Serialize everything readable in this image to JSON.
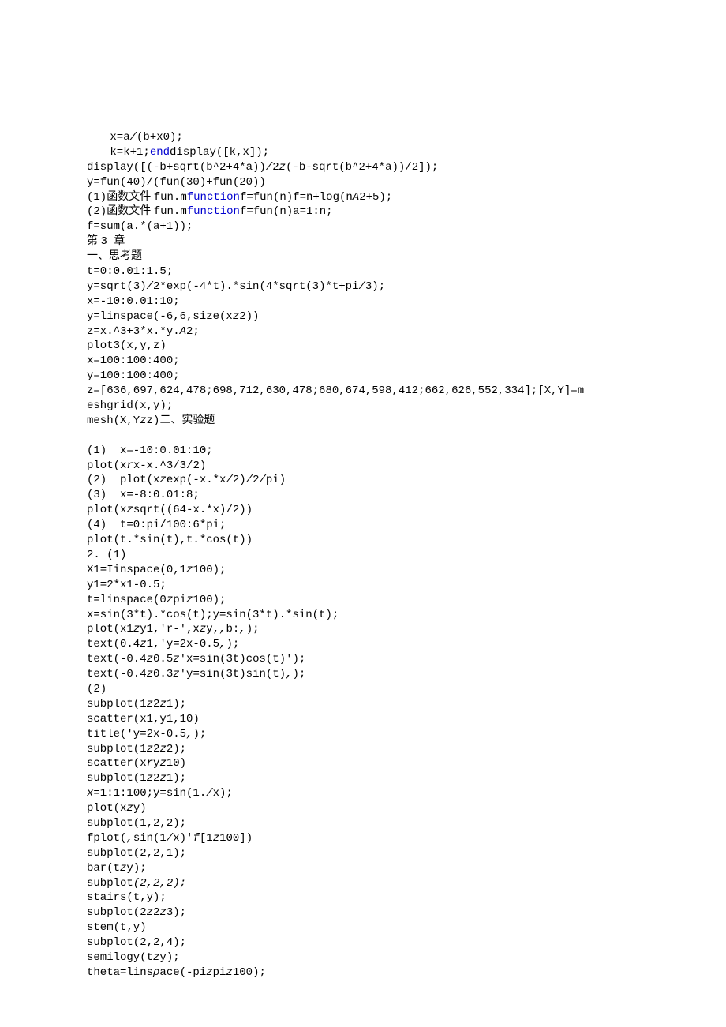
{
  "lines": [
    {
      "indent": true,
      "parts": [
        {
          "t": "x=a",
          "c": ""
        },
        {
          "t": "/",
          "c": "it"
        },
        {
          "t": "(b+x0);",
          "c": ""
        }
      ]
    },
    {
      "indent": true,
      "parts": [
        {
          "t": "k=k+1;",
          "c": ""
        },
        {
          "t": "end",
          "c": "kw"
        },
        {
          "t": "display([k,x]);",
          "c": ""
        }
      ]
    },
    {
      "parts": [
        {
          "t": "display([(-b+sqrt(b^2+4*a))",
          "c": ""
        },
        {
          "t": "/",
          "c": "it"
        },
        {
          "t": "2",
          "c": ""
        },
        {
          "t": "z",
          "c": "it"
        },
        {
          "t": "(-b-sqrt(b^2+4*a))/2]);",
          "c": ""
        }
      ]
    },
    {
      "parts": [
        {
          "t": "y=fun(40)/(fun(30)+fun(20))",
          "c": ""
        }
      ]
    },
    {
      "parts": [
        {
          "t": "(1)",
          "c": ""
        },
        {
          "t": "函数文件 ",
          "c": "zh"
        },
        {
          "t": "fun.m",
          "c": ""
        },
        {
          "t": "function",
          "c": "kw"
        },
        {
          "t": "f=fun(n)f=n+log(n",
          "c": ""
        },
        {
          "t": "A",
          "c": "it"
        },
        {
          "t": "2+5);",
          "c": ""
        }
      ]
    },
    {
      "parts": [
        {
          "t": "(2)",
          "c": ""
        },
        {
          "t": "函数文件 ",
          "c": "zh"
        },
        {
          "t": "fun.m",
          "c": ""
        },
        {
          "t": "function",
          "c": "kw"
        },
        {
          "t": "f=fun(n)a=1:n;",
          "c": ""
        }
      ]
    },
    {
      "parts": [
        {
          "t": "f=sum(a.*(a+1));",
          "c": ""
        }
      ]
    },
    {
      "parts": [
        {
          "t": "第 ",
          "c": "zh"
        },
        {
          "t": "3 ",
          "c": ""
        },
        {
          "t": "章",
          "c": "zh"
        }
      ]
    },
    {
      "parts": [
        {
          "t": "一、思考题",
          "c": "zh"
        }
      ]
    },
    {
      "parts": [
        {
          "t": "t=0:0.01:1.5;",
          "c": ""
        }
      ]
    },
    {
      "parts": [
        {
          "t": "y=sqrt(3)",
          "c": ""
        },
        {
          "t": "/",
          "c": "it"
        },
        {
          "t": "2*exp(-4*t).*sin(4*sqrt(3)*t+pi",
          "c": ""
        },
        {
          "t": "/",
          "c": "it"
        },
        {
          "t": "3);",
          "c": ""
        }
      ]
    },
    {
      "parts": [
        {
          "t": "x=-10:0.01:10;",
          "c": ""
        }
      ]
    },
    {
      "parts": [
        {
          "t": "y=linspace(-6,6,size(x",
          "c": ""
        },
        {
          "t": "z",
          "c": "it"
        },
        {
          "t": "2))",
          "c": ""
        }
      ]
    },
    {
      "parts": [
        {
          "t": "z=x.^3+3*x.*y.",
          "c": ""
        },
        {
          "t": "A",
          "c": "it"
        },
        {
          "t": "2;",
          "c": ""
        }
      ]
    },
    {
      "parts": [
        {
          "t": "plot3(x,y,z)",
          "c": ""
        }
      ]
    },
    {
      "parts": [
        {
          "t": "x=100:100:400;",
          "c": ""
        }
      ]
    },
    {
      "parts": [
        {
          "t": "y=100:100:400;",
          "c": ""
        }
      ]
    },
    {
      "parts": [
        {
          "t": "z=[636,697,624,478;698,712,630,478;680,674,598,412;662,626,552,334];[X,Y]=m",
          "c": ""
        }
      ]
    },
    {
      "parts": [
        {
          "t": "eshgrid(x,y);",
          "c": ""
        }
      ]
    },
    {
      "parts": [
        {
          "t": "mesh(X,Y",
          "c": ""
        },
        {
          "t": "z",
          "c": "it"
        },
        {
          "t": "z)",
          "c": ""
        },
        {
          "t": "二、实验题",
          "c": "zh"
        }
      ]
    },
    {
      "parts": [
        {
          "t": " ",
          "c": ""
        }
      ]
    },
    {
      "parts": [
        {
          "t": "(1)  x=-10:0.01:10;",
          "c": ""
        }
      ]
    },
    {
      "parts": [
        {
          "t": "plot(x",
          "c": ""
        },
        {
          "t": "r",
          "c": "it"
        },
        {
          "t": "x-x.^3/3/2)",
          "c": ""
        }
      ]
    },
    {
      "parts": [
        {
          "t": "(2)  plot(x",
          "c": ""
        },
        {
          "t": "z",
          "c": "it"
        },
        {
          "t": "exp(-x.*x",
          "c": ""
        },
        {
          "t": "/",
          "c": "it"
        },
        {
          "t": "2)",
          "c": ""
        },
        {
          "t": "/",
          "c": "it"
        },
        {
          "t": "2",
          "c": ""
        },
        {
          "t": "/",
          "c": "it"
        },
        {
          "t": "pi)",
          "c": ""
        }
      ]
    },
    {
      "parts": [
        {
          "t": "(3)  x=-8:0.01:8;",
          "c": ""
        }
      ]
    },
    {
      "parts": [
        {
          "t": "plot(x",
          "c": ""
        },
        {
          "t": "z",
          "c": "it"
        },
        {
          "t": "sqrt((64-x.*x)/2))",
          "c": ""
        }
      ]
    },
    {
      "parts": [
        {
          "t": "(4)  t=0:pi/100:6*pi;",
          "c": ""
        }
      ]
    },
    {
      "parts": [
        {
          "t": "plot(t.*sin(t),t.*cos(t))",
          "c": ""
        }
      ]
    },
    {
      "parts": [
        {
          "t": "2. (1)",
          "c": ""
        }
      ]
    },
    {
      "parts": [
        {
          "t": "X1=Iinspace(0,1",
          "c": ""
        },
        {
          "t": "z",
          "c": "it"
        },
        {
          "t": "100);",
          "c": ""
        }
      ]
    },
    {
      "parts": [
        {
          "t": "y1=2*x1-0.5;",
          "c": ""
        }
      ]
    },
    {
      "parts": [
        {
          "t": "t=linspace(0",
          "c": ""
        },
        {
          "t": "z",
          "c": "it"
        },
        {
          "t": "pi",
          "c": ""
        },
        {
          "t": "z",
          "c": "it"
        },
        {
          "t": "100);",
          "c": ""
        }
      ]
    },
    {
      "parts": [
        {
          "t": "x=sin(3*t).*cos(t);y=sin(3*t).*sin(t);",
          "c": ""
        }
      ]
    },
    {
      "parts": [
        {
          "t": "plot(x1",
          "c": ""
        },
        {
          "t": "z",
          "c": "it"
        },
        {
          "t": "y1,'r-',x",
          "c": ""
        },
        {
          "t": "z",
          "c": "it"
        },
        {
          "t": "y,",
          "c": ""
        },
        {
          "t": ",",
          "c": "it"
        },
        {
          "t": "b:",
          "c": ""
        },
        {
          "t": ",",
          "c": "it"
        },
        {
          "t": ");",
          "c": ""
        }
      ]
    },
    {
      "parts": [
        {
          "t": "text(0.4",
          "c": ""
        },
        {
          "t": "z",
          "c": "it"
        },
        {
          "t": "1,'y=2x-0.5",
          "c": ""
        },
        {
          "t": ",",
          "c": "it"
        },
        {
          "t": ");",
          "c": ""
        }
      ]
    },
    {
      "parts": [
        {
          "t": "text(-0.4",
          "c": ""
        },
        {
          "t": "z",
          "c": "it"
        },
        {
          "t": "0.5",
          "c": ""
        },
        {
          "t": "z",
          "c": "it"
        },
        {
          "t": "'x=sin(3t)cos(t)');",
          "c": ""
        }
      ]
    },
    {
      "parts": [
        {
          "t": "text(-0.4",
          "c": ""
        },
        {
          "t": "z",
          "c": "it"
        },
        {
          "t": "0.3",
          "c": ""
        },
        {
          "t": "z",
          "c": "it"
        },
        {
          "t": "'y=sin(3t)sin(t)",
          "c": ""
        },
        {
          "t": ",",
          "c": "it"
        },
        {
          "t": ");",
          "c": ""
        }
      ]
    },
    {
      "parts": [
        {
          "t": "(2)",
          "c": ""
        }
      ]
    },
    {
      "parts": [
        {
          "t": "subplot(1",
          "c": ""
        },
        {
          "t": "z",
          "c": "it"
        },
        {
          "t": "2",
          "c": ""
        },
        {
          "t": "z",
          "c": "it"
        },
        {
          "t": "1);",
          "c": ""
        }
      ]
    },
    {
      "parts": [
        {
          "t": "scatter(x1,y1,10)",
          "c": ""
        }
      ]
    },
    {
      "parts": [
        {
          "t": "title('y=2x-0.5",
          "c": ""
        },
        {
          "t": ",",
          "c": "it"
        },
        {
          "t": ");",
          "c": ""
        }
      ]
    },
    {
      "parts": [
        {
          "t": "subplot(1",
          "c": ""
        },
        {
          "t": "z",
          "c": "it"
        },
        {
          "t": "2",
          "c": ""
        },
        {
          "t": "z",
          "c": "it"
        },
        {
          "t": "2);",
          "c": ""
        }
      ]
    },
    {
      "parts": [
        {
          "t": "scatter(x",
          "c": ""
        },
        {
          "t": "r",
          "c": "it"
        },
        {
          "t": "y",
          "c": ""
        },
        {
          "t": "z",
          "c": "it"
        },
        {
          "t": "10)",
          "c": ""
        }
      ]
    },
    {
      "parts": [
        {
          "t": "subplot(1",
          "c": ""
        },
        {
          "t": "z",
          "c": "it"
        },
        {
          "t": "2",
          "c": ""
        },
        {
          "t": "z",
          "c": "it"
        },
        {
          "t": "1);",
          "c": ""
        }
      ]
    },
    {
      "parts": [
        {
          "t": "x",
          "c": "it"
        },
        {
          "t": "=1:1:100;y=sin(1.",
          "c": ""
        },
        {
          "t": "/",
          "c": "it"
        },
        {
          "t": "x);",
          "c": ""
        }
      ]
    },
    {
      "parts": [
        {
          "t": "plot(x",
          "c": ""
        },
        {
          "t": "z",
          "c": "it"
        },
        {
          "t": "y)",
          "c": ""
        }
      ]
    },
    {
      "parts": [
        {
          "t": "subplot(1,2,2);",
          "c": ""
        }
      ]
    },
    {
      "parts": [
        {
          "t": "fplot(",
          "c": ""
        },
        {
          "t": ",",
          "c": "it"
        },
        {
          "t": "sin(1",
          "c": ""
        },
        {
          "t": "/",
          "c": "it"
        },
        {
          "t": "x)'",
          "c": ""
        },
        {
          "t": "f",
          "c": "it"
        },
        {
          "t": "[1",
          "c": ""
        },
        {
          "t": "z",
          "c": "it"
        },
        {
          "t": "100])",
          "c": ""
        }
      ]
    },
    {
      "parts": [
        {
          "t": "subplot(2,2,1);",
          "c": ""
        }
      ]
    },
    {
      "parts": [
        {
          "t": "bar(t",
          "c": ""
        },
        {
          "t": "z",
          "c": "it"
        },
        {
          "t": "y);",
          "c": ""
        }
      ]
    },
    {
      "parts": [
        {
          "t": "subplot",
          "c": ""
        },
        {
          "t": "(2,2,2);",
          "c": "it"
        }
      ]
    },
    {
      "parts": [
        {
          "t": "stairs(t,y);",
          "c": ""
        }
      ]
    },
    {
      "parts": [
        {
          "t": "subplot(2",
          "c": ""
        },
        {
          "t": "z",
          "c": "it"
        },
        {
          "t": "2",
          "c": ""
        },
        {
          "t": "z",
          "c": "it"
        },
        {
          "t": "3);",
          "c": ""
        }
      ]
    },
    {
      "parts": [
        {
          "t": "stem(t,y)",
          "c": ""
        }
      ]
    },
    {
      "parts": [
        {
          "t": "subplot(2,2,4);",
          "c": ""
        }
      ]
    },
    {
      "parts": [
        {
          "t": "semilogy(t",
          "c": ""
        },
        {
          "t": "z",
          "c": "it"
        },
        {
          "t": "y);",
          "c": ""
        }
      ]
    },
    {
      "parts": [
        {
          "t": "theta=lins",
          "c": ""
        },
        {
          "t": "ρ",
          "c": "it"
        },
        {
          "t": "ace(-pi",
          "c": ""
        },
        {
          "t": "z",
          "c": "it"
        },
        {
          "t": "pi",
          "c": ""
        },
        {
          "t": "z",
          "c": "it"
        },
        {
          "t": "100);",
          "c": ""
        }
      ]
    }
  ]
}
